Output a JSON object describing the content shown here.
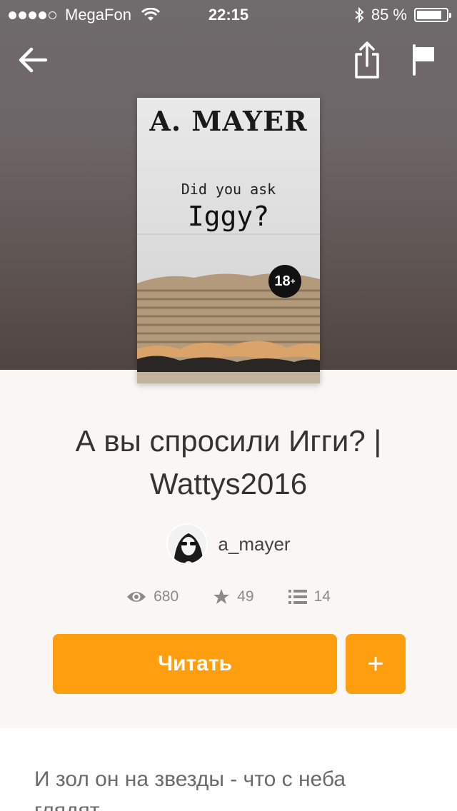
{
  "status_bar": {
    "carrier": "MegaFon",
    "time": "22:15",
    "battery_percent": "85 %",
    "battery_level": 0.85,
    "signal_bars": 4
  },
  "nav": {
    "back_icon": "arrow-left-icon",
    "share_icon": "share-icon",
    "report_icon": "flag-icon"
  },
  "cover": {
    "author": "A. MAYER",
    "subtitle": "Did you ask",
    "title": "Iggy?",
    "rating_badge": "18",
    "rating_badge_plus": "+"
  },
  "story": {
    "title": "А вы спросили Игги? | Wattys2016",
    "author": "a_mayer"
  },
  "stats": {
    "reads": "680",
    "votes": "49",
    "parts": "14"
  },
  "actions": {
    "read_label": "Читать",
    "add_label": "+"
  },
  "description": {
    "text": "И зол он на звезды - что с неба глядят"
  },
  "colors": {
    "accent": "#ff9e0f",
    "background": "#f9f6f3"
  }
}
